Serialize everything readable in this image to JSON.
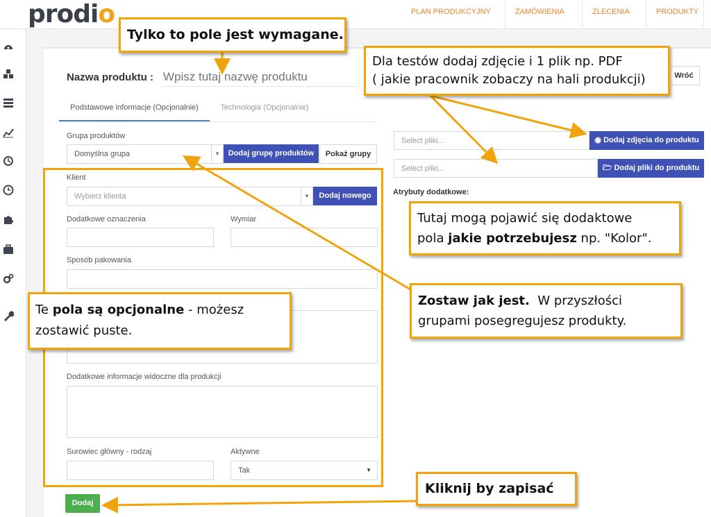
{
  "logo": "prodio",
  "nav": [
    "PLAN PRODUKCYJNY",
    "ZAMÓWIENIA",
    "ZLECENIA",
    "PRODUKTY"
  ],
  "sidebar_icons": [
    "dashboard-icon",
    "cubes-icon",
    "list-icon",
    "chart-icon",
    "history-icon",
    "clock-icon",
    "puzzle-icon",
    "briefcase-icon",
    "cogs-icon",
    "wrench-icon"
  ],
  "form": {
    "product_name_label": "Nazwa produktu :",
    "product_name_placeholder": "Wpisz tutaj nazwę produktu",
    "back_button": "Wróć",
    "tabs": [
      "Podstawowe informacje (Opcjonalnie)",
      "Technologia (Opcjonalnie)"
    ],
    "group_label": "Grupa produktów",
    "group_value": "Domyślna grupa",
    "add_group_button": "Dodaj grupę produktów",
    "show_groups_button": "Pokaż grupy",
    "client_label": "Klient",
    "client_placeholder": "Wybierz klienta",
    "add_new_button": "Dodaj nowego",
    "extra_marking_label": "Dodatkowe oznaczenia",
    "dimension_label": "Wymiar",
    "packing_label": "Sposób pakowania",
    "production_info_label": "Dodatkowe informacje widoczne dla produkcji",
    "raw_material_label": "Surowiec główny - rodzaj",
    "active_label": "Aktywne",
    "active_value": "Tak",
    "save_button": "Dodaj",
    "photos_placeholder": "Select pliki...",
    "add_photos_button": "Dodaj zdjęcia do produktu",
    "files_placeholder": "Select pliki...",
    "add_files_button": "Dodaj pliki do produktu",
    "extra_attributes_label": "Atrybuty dodatkowe:"
  },
  "callouts": {
    "required": "Tylko to pole jest wymagane.",
    "test_line1": "Dla testów dodaj zdjęcie i 1 plik np. PDF",
    "test_line2": "( jakie pracownik zobaczy na hali produkcji)",
    "attrs_a": "Tutaj mogą pojawić się dodaktowe",
    "attrs_b": "pola ",
    "attrs_bold": "jakie potrzebujesz",
    "attrs_c": " np. \"Kolor\".",
    "leave_bold": "Zostaw jak jest.",
    "leave_a": "  W przyszłości",
    "leave_b": "grupami posegregujesz produkty.",
    "opt_a": "Te ",
    "opt_bold": "pola są opcjonalne",
    "opt_b": " - możesz",
    "opt_c": "zostawić puste.",
    "save": "Kliknij by zapisać"
  },
  "colors": {
    "accent_orange": "#f0a30a",
    "primary_blue": "#3f51b5",
    "save_green": "#4cae4c"
  }
}
